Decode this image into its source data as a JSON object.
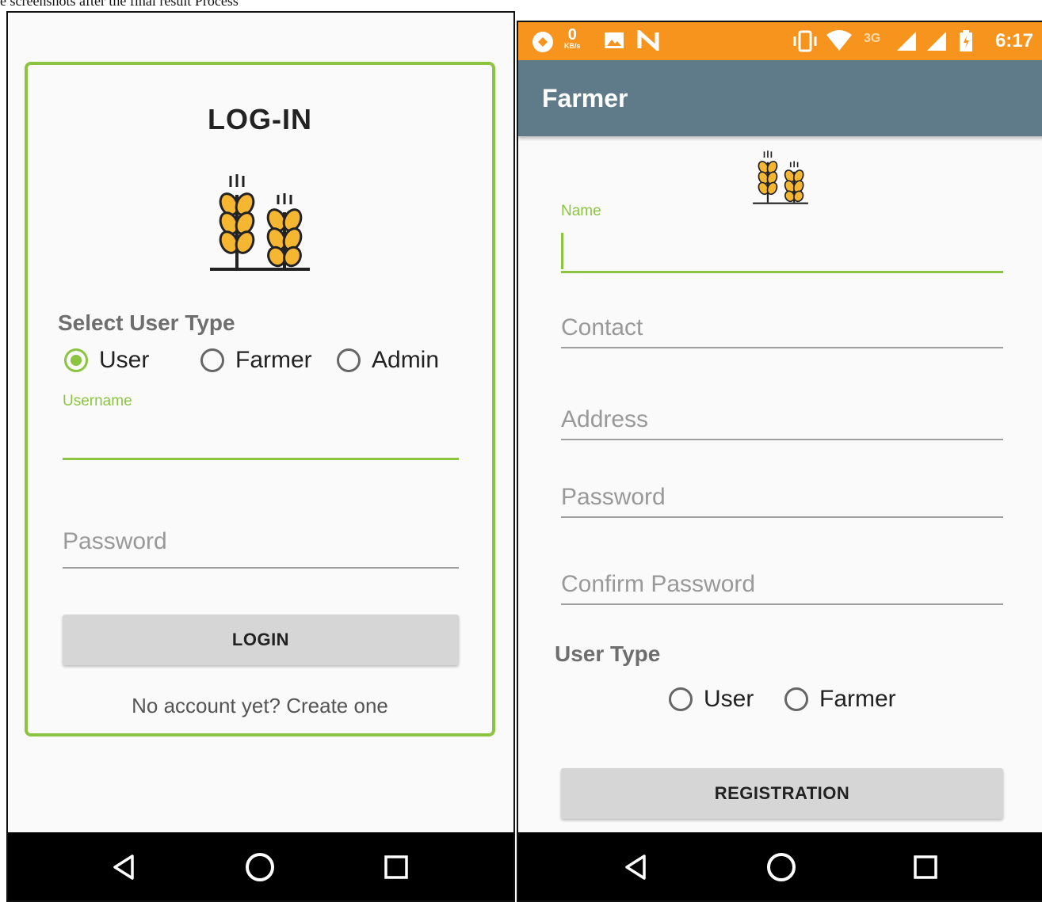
{
  "caption": "e screenshots after the final result Process",
  "colors": {
    "accent_green": "#8bc43f",
    "statusbar_orange": "#f7941d",
    "appbar_slate": "#5f7b8a",
    "navbar_black": "#000000",
    "wheat_yellow": "#f5b731"
  },
  "login_screen": {
    "title": "LOG-IN",
    "logo_icon": "wheat-logo-icon",
    "select_user_type_label": "Select User Type",
    "user_types": [
      {
        "label": "User",
        "checked": true
      },
      {
        "label": "Farmer",
        "checked": false
      },
      {
        "label": "Admin",
        "checked": false
      }
    ],
    "username_label": "Username",
    "username_value": "",
    "password_placeholder": "Password",
    "login_button": "LOGIN",
    "create_account_text": "No account yet? Create one"
  },
  "register_screen": {
    "status": {
      "speed_value": "0",
      "speed_unit": "KB/s",
      "network_label": "3G",
      "time": "6:17",
      "icons": [
        "app-notification-icon",
        "image-icon",
        "n-icon",
        "vibrate-icon",
        "wifi-icon",
        "signal-icon",
        "signal-icon",
        "battery-icon"
      ]
    },
    "appbar_title": "Farmer",
    "logo_icon": "wheat-logo-icon",
    "name_label": "Name",
    "name_value": "",
    "contact_placeholder": "Contact",
    "address_placeholder": "Address",
    "password_placeholder": "Password",
    "confirm_password_placeholder": "Confirm Password",
    "user_type_label": "User Type",
    "user_types": [
      {
        "label": "User",
        "checked": false
      },
      {
        "label": "Farmer",
        "checked": false
      }
    ],
    "registration_button": "REGISTRATION"
  },
  "navbar": {
    "icons": [
      "back-icon",
      "home-icon",
      "recents-icon"
    ]
  }
}
